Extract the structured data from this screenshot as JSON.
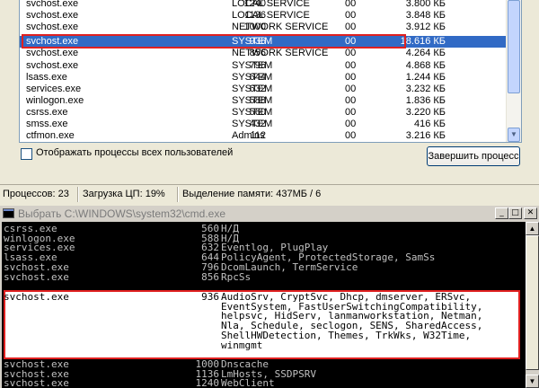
{
  "taskmgr": {
    "processes": [
      {
        "name": "svchost.exe",
        "pid": "1240",
        "user": "LOCAL SERVICE",
        "cpu": "00",
        "mem": "3.800 КБ",
        "selected": false
      },
      {
        "name": "svchost.exe",
        "pid": "1136",
        "user": "LOCAL SERVICE",
        "cpu": "00",
        "mem": "3.848 КБ",
        "selected": false
      },
      {
        "name": "svchost.exe",
        "pid": "1000",
        "user": "NETWORK SERVICE",
        "cpu": "00",
        "mem": "3.912 КБ",
        "selected": false
      },
      {
        "name": "svchost.exe",
        "pid": "936",
        "user": "SYSTEM",
        "cpu": "00",
        "mem": "18.616 КБ",
        "selected": true
      },
      {
        "name": "svchost.exe",
        "pid": "856",
        "user": "NETWORK SERVICE",
        "cpu": "00",
        "mem": "4.264 КБ",
        "selected": false
      },
      {
        "name": "svchost.exe",
        "pid": "796",
        "user": "SYSTEM",
        "cpu": "00",
        "mem": "4.868 КБ",
        "selected": false
      },
      {
        "name": "lsass.exe",
        "pid": "644",
        "user": "SYSTEM",
        "cpu": "00",
        "mem": "1.244 КБ",
        "selected": false
      },
      {
        "name": "services.exe",
        "pid": "632",
        "user": "SYSTEM",
        "cpu": "00",
        "mem": "3.232 КБ",
        "selected": false
      },
      {
        "name": "winlogon.exe",
        "pid": "588",
        "user": "SYSTEM",
        "cpu": "00",
        "mem": "1.836 КБ",
        "selected": false
      },
      {
        "name": "csrss.exe",
        "pid": "560",
        "user": "SYSTEM",
        "cpu": "00",
        "mem": "3.220 КБ",
        "selected": false
      },
      {
        "name": "smss.exe",
        "pid": "432",
        "user": "SYSTEM",
        "cpu": "00",
        "mem": "416 КБ",
        "selected": false
      },
      {
        "name": "ctfmon.exe",
        "pid": "112",
        "user": "Admins",
        "cpu": "00",
        "mem": "3.216 КБ",
        "selected": false
      }
    ],
    "show_all_users_label": "Отображать процессы всех пользователей",
    "show_all_users_checked": false,
    "end_process_label": "Завершить процесс",
    "status": {
      "processes": "Процессов: 23",
      "cpu": "Загрузка ЦП: 19%",
      "memory": "Выделение памяти: 437МБ / 6"
    }
  },
  "cmd": {
    "title": "Выбрать C:\\WINDOWS\\system32\\cmd.exe",
    "lines_before": [
      {
        "name": "csrss.exe",
        "pid": "560",
        "services": "Н/Д"
      },
      {
        "name": "winlogon.exe",
        "pid": "588",
        "services": "Н/Д"
      },
      {
        "name": "services.exe",
        "pid": "632",
        "services": "Eventlog, PlugPlay"
      },
      {
        "name": "lsass.exe",
        "pid": "644",
        "services": "PolicyAgent, ProtectedStorage, SamSs"
      },
      {
        "name": "svchost.exe",
        "pid": "796",
        "services": "DcomLaunch, TermService"
      },
      {
        "name": "svchost.exe",
        "pid": "856",
        "services": "RpcSs"
      }
    ],
    "highlight": {
      "name": "svchost.exe",
      "pid": "936",
      "services": [
        "AudioSrv, CryptSvc, Dhcp, dmserver, ERSvc,",
        "EventSystem, FastUserSwitchingCompatibility,",
        "helpsvc, HidServ, lanmanworkstation, Netman,",
        "Nla, Schedule, seclogon, SENS, SharedAccess,",
        "ShellHWDetection, Themes, TrkWks, W32Time,",
        "winmgmt"
      ]
    },
    "lines_after": [
      {
        "name": "svchost.exe",
        "pid": "1000",
        "services": "Dnscache"
      },
      {
        "name": "svchost.exe",
        "pid": "1136",
        "services": "LmHosts, SSDPSRV"
      },
      {
        "name": "svchost.exe",
        "pid": "1240",
        "services": "WebClient"
      }
    ]
  },
  "colors": {
    "selection": "#316ac5",
    "annotation_red": "#e02020",
    "console_bg": "#000000",
    "console_text": "#c0c0c0"
  }
}
